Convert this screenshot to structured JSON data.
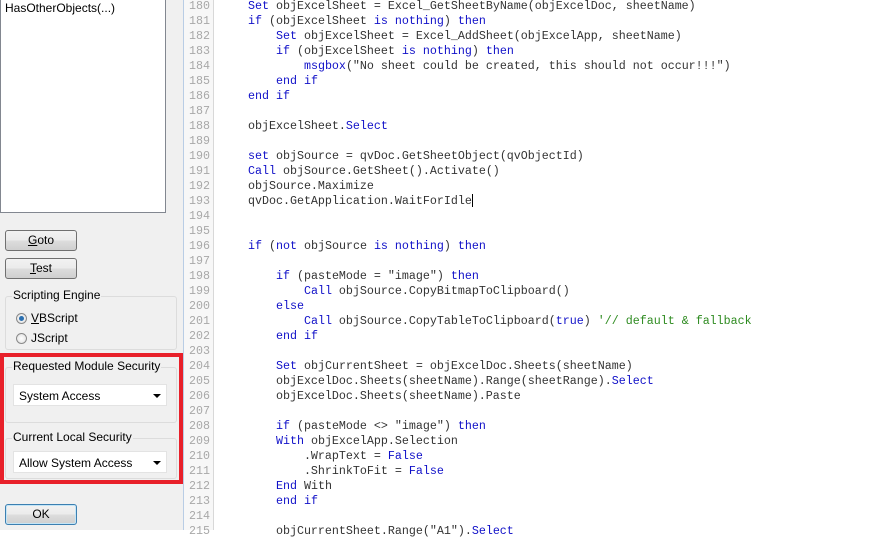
{
  "left_panel": {
    "function_list": [
      "HasOtherObjects(...)"
    ],
    "goto_button": {
      "label": "Goto",
      "mnemonic": "G",
      "rest": "oto"
    },
    "test_button": {
      "label": "Test",
      "mnemonic": "T",
      "rest": "est"
    },
    "scripting_engine": {
      "title": "Scripting Engine",
      "options": [
        {
          "label": "VBScript",
          "mnemonic": "V",
          "rest": "BScript",
          "selected": true
        },
        {
          "label": "JScript",
          "selected": false
        }
      ]
    },
    "requested_module_security": {
      "title": "Requested Module Security",
      "value": "System Access"
    },
    "current_local_security": {
      "title": "Current Local Security",
      "value": "Allow System Access"
    },
    "highlight_color": "#e8202a",
    "ok_button": {
      "label": "OK"
    }
  },
  "editor": {
    "lines": [
      {
        "n": "180",
        "seg": [
          [
            "    ",
            ""
          ],
          [
            "Set",
            "k"
          ],
          [
            " objExcelSheet = Excel_GetSheetByName(objExcelDoc, sheetName)",
            ""
          ]
        ]
      },
      {
        "n": "181",
        "seg": [
          [
            "    ",
            ""
          ],
          [
            "if",
            "k"
          ],
          [
            " (objExcelSheet ",
            ""
          ],
          [
            "is nothing",
            "k"
          ],
          [
            ") ",
            ""
          ],
          [
            "then",
            "k"
          ]
        ]
      },
      {
        "n": "182",
        "seg": [
          [
            "        ",
            ""
          ],
          [
            "Set",
            "k"
          ],
          [
            " objExcelSheet = Excel_AddSheet(objExcelApp, sheetName)",
            ""
          ]
        ]
      },
      {
        "n": "183",
        "seg": [
          [
            "        ",
            ""
          ],
          [
            "if",
            "k"
          ],
          [
            " (objExcelSheet ",
            ""
          ],
          [
            "is nothing",
            "k"
          ],
          [
            ") ",
            ""
          ],
          [
            "then",
            "k"
          ]
        ]
      },
      {
        "n": "184",
        "seg": [
          [
            "            ",
            ""
          ],
          [
            "msgbox",
            "k"
          ],
          [
            "(\"No sheet could be created, this should not occur!!!\")",
            ""
          ]
        ]
      },
      {
        "n": "185",
        "seg": [
          [
            "        ",
            ""
          ],
          [
            "end if",
            "k"
          ]
        ]
      },
      {
        "n": "186",
        "seg": [
          [
            "    ",
            ""
          ],
          [
            "end if",
            "k"
          ]
        ]
      },
      {
        "n": "187",
        "seg": []
      },
      {
        "n": "188",
        "seg": [
          [
            "    objExcelSheet.",
            ""
          ],
          [
            "Select",
            "k"
          ]
        ]
      },
      {
        "n": "189",
        "seg": []
      },
      {
        "n": "190",
        "seg": [
          [
            "    ",
            ""
          ],
          [
            "set",
            "k"
          ],
          [
            " objSource = qvDoc.GetSheetObject(qvObjectId)",
            ""
          ]
        ]
      },
      {
        "n": "191",
        "seg": [
          [
            "    ",
            ""
          ],
          [
            "Call",
            "k"
          ],
          [
            " objSource.GetSheet().Activate()",
            ""
          ]
        ]
      },
      {
        "n": "192",
        "seg": [
          [
            "    objSource.Maximize",
            ""
          ]
        ]
      },
      {
        "n": "193",
        "seg": [
          [
            "    qvDoc.GetApplication.WaitForIdle",
            ""
          ]
        ],
        "caret": true
      },
      {
        "n": "194",
        "seg": []
      },
      {
        "n": "195",
        "seg": []
      },
      {
        "n": "196",
        "seg": [
          [
            "    ",
            ""
          ],
          [
            "if",
            "k"
          ],
          [
            " (",
            ""
          ],
          [
            "not",
            "k"
          ],
          [
            " objSource ",
            ""
          ],
          [
            "is nothing",
            "k"
          ],
          [
            ") ",
            ""
          ],
          [
            "then",
            "k"
          ]
        ]
      },
      {
        "n": "197",
        "seg": []
      },
      {
        "n": "198",
        "seg": [
          [
            "        ",
            ""
          ],
          [
            "if",
            "k"
          ],
          [
            " (pasteMode = \"image\") ",
            ""
          ],
          [
            "then",
            "k"
          ]
        ]
      },
      {
        "n": "199",
        "seg": [
          [
            "            ",
            ""
          ],
          [
            "Call",
            "k"
          ],
          [
            " objSource.CopyBitmapToClipboard()",
            ""
          ]
        ]
      },
      {
        "n": "200",
        "seg": [
          [
            "        ",
            ""
          ],
          [
            "else",
            "k"
          ]
        ]
      },
      {
        "n": "201",
        "seg": [
          [
            "            ",
            ""
          ],
          [
            "Call",
            "k"
          ],
          [
            " objSource.CopyTableToClipboard(",
            ""
          ],
          [
            "true",
            "k"
          ],
          [
            ") ",
            ""
          ],
          [
            "'// default & fallback",
            "c"
          ]
        ]
      },
      {
        "n": "202",
        "seg": [
          [
            "        ",
            ""
          ],
          [
            "end if",
            "k"
          ]
        ]
      },
      {
        "n": "203",
        "seg": []
      },
      {
        "n": "204",
        "seg": [
          [
            "        ",
            ""
          ],
          [
            "Set",
            "k"
          ],
          [
            " objCurrentSheet = objExcelDoc.Sheets(sheetName)",
            ""
          ]
        ]
      },
      {
        "n": "205",
        "seg": [
          [
            "        objExcelDoc.Sheets(sheetName).Range(sheetRange).",
            ""
          ],
          [
            "Select",
            "k"
          ]
        ]
      },
      {
        "n": "206",
        "seg": [
          [
            "        objExcelDoc.Sheets(sheetName).Paste",
            ""
          ]
        ]
      },
      {
        "n": "207",
        "seg": []
      },
      {
        "n": "208",
        "seg": [
          [
            "        ",
            ""
          ],
          [
            "if",
            "k"
          ],
          [
            " (pasteMode <> \"image\") ",
            ""
          ],
          [
            "then",
            "k"
          ]
        ]
      },
      {
        "n": "209",
        "seg": [
          [
            "        ",
            ""
          ],
          [
            "With",
            "k"
          ],
          [
            " objExcelApp.Selection",
            ""
          ]
        ]
      },
      {
        "n": "210",
        "seg": [
          [
            "            .WrapText = ",
            ""
          ],
          [
            "False",
            "k"
          ]
        ]
      },
      {
        "n": "211",
        "seg": [
          [
            "            .ShrinkToFit = ",
            ""
          ],
          [
            "False",
            "k"
          ]
        ]
      },
      {
        "n": "212",
        "seg": [
          [
            "        ",
            ""
          ],
          [
            "End",
            "k"
          ],
          [
            " With",
            ""
          ]
        ]
      },
      {
        "n": "213",
        "seg": [
          [
            "        ",
            ""
          ],
          [
            "end if",
            "k"
          ]
        ]
      },
      {
        "n": "214",
        "seg": []
      },
      {
        "n": "215",
        "seg": [
          [
            "        objCurrentSheet.Range(\"A1\").",
            ""
          ],
          [
            "Select",
            "k"
          ]
        ]
      }
    ]
  }
}
